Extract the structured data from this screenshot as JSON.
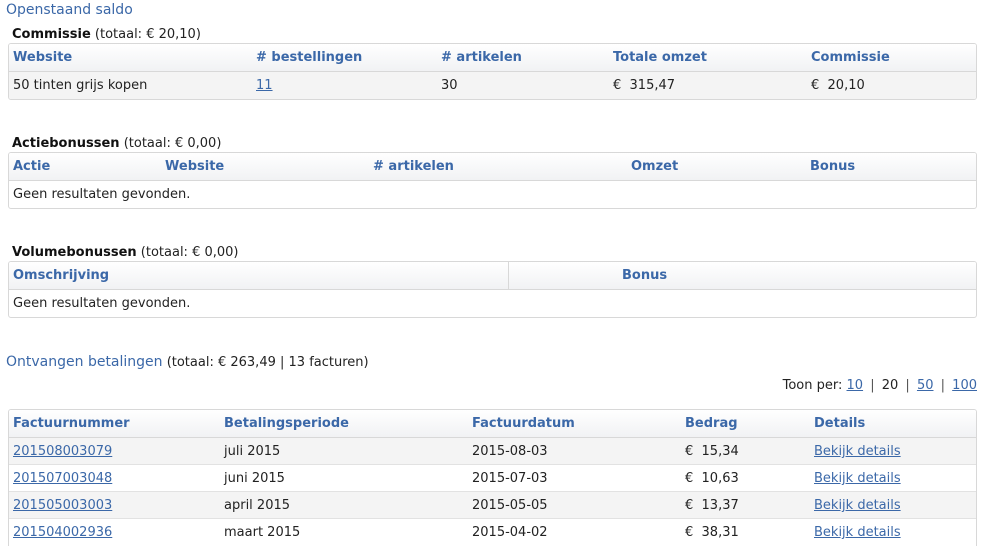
{
  "page_title": "Openstaand saldo",
  "commissie": {
    "title": "Commissie",
    "total": "(totaal: € 20,10)",
    "headers": [
      "Website",
      "# bestellingen",
      "# artikelen",
      "Totale omzet",
      "Commissie"
    ],
    "rows": [
      {
        "website": "50 tinten grijs kopen",
        "bestellingen": "11",
        "artikelen": "30",
        "omzet": "€  315,47",
        "commissie": "€  20,10"
      }
    ]
  },
  "actiebonussen": {
    "title": "Actiebonussen",
    "total": "(totaal: € 0,00)",
    "headers": [
      "Actie",
      "Website",
      "# artikelen",
      "Omzet",
      "Bonus"
    ],
    "empty": "Geen resultaten gevonden."
  },
  "volumebonussen": {
    "title": "Volumebonussen",
    "total": "(totaal: € 0,00)",
    "headers": [
      "Omschrijving",
      "Bonus"
    ],
    "empty": "Geen resultaten gevonden."
  },
  "ontvangen": {
    "title": "Ontvangen betalingen",
    "summary_prefix": "(totaal: € 263,49",
    "summary_sep": "|",
    "summary_suffix": "13 facturen)",
    "pager": {
      "label": "Toon per:",
      "opt10": "10",
      "opt20": "20",
      "opt50": "50",
      "opt100": "100",
      "sep": "|"
    },
    "headers": [
      "Factuurnummer",
      "Betalingsperiode",
      "Factuurdatum",
      "Bedrag",
      "Details"
    ],
    "rows": [
      {
        "nummer": "201508003079",
        "periode": "juli 2015",
        "datum": "2015-08-03",
        "bedrag": "€  15,34",
        "details": "Bekijk details"
      },
      {
        "nummer": "201507003048",
        "periode": "juni 2015",
        "datum": "2015-07-03",
        "bedrag": "€  10,63",
        "details": "Bekijk details"
      },
      {
        "nummer": "201505003003",
        "periode": "april 2015",
        "datum": "2015-05-05",
        "bedrag": "€  13,37",
        "details": "Bekijk details"
      },
      {
        "nummer": "201504002936",
        "periode": "maart 2015",
        "datum": "2015-04-02",
        "bedrag": "€  38,31",
        "details": "Bekijk details"
      }
    ]
  }
}
